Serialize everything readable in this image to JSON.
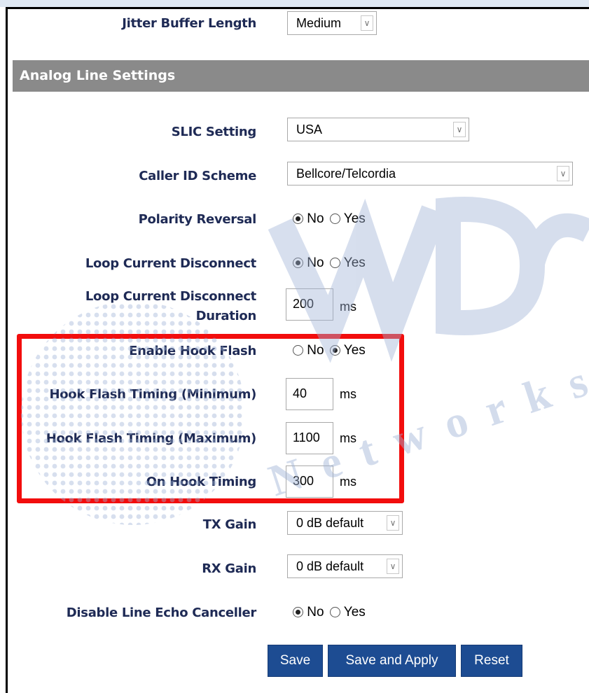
{
  "settings": {
    "jitter_buffer_label": "Jitter Buffer Length",
    "jitter_buffer_value": "Medium"
  },
  "section": {
    "title": "Analog Line Settings"
  },
  "fields": {
    "slic_label": "SLIC Setting",
    "slic_value": "USA",
    "caller_id_label": "Caller ID Scheme",
    "caller_id_value": "Bellcore/Telcordia",
    "polarity_label": "Polarity Reversal",
    "loop_disconnect_label": "Loop Current Disconnect",
    "loop_duration_label_1": "Loop Current Disconnect",
    "loop_duration_label_2": "Duration",
    "loop_duration_value": "200",
    "hook_flash_label": "Enable Hook Flash",
    "hook_min_label": "Hook Flash Timing (Minimum)",
    "hook_min_value": "40",
    "hook_max_label": "Hook Flash Timing (Maximum)",
    "hook_max_value": "1100",
    "on_hook_label": "On Hook Timing",
    "on_hook_value": "300",
    "tx_gain_label": "TX Gain",
    "tx_gain_value": "0 dB default",
    "rx_gain_label": "RX Gain",
    "rx_gain_value": "0 dB default",
    "echo_label": "Disable Line Echo Canceller"
  },
  "common": {
    "no": "No",
    "yes": "Yes",
    "ms": "ms"
  },
  "buttons": {
    "save": "Save",
    "save_apply": "Save and Apply",
    "reset": "Reset"
  },
  "watermark": {
    "brand": "WDC",
    "sub": "Networks",
    "color": "#9fb3d6"
  },
  "colors": {
    "section_bar": "#8a8a8a",
    "button": "#1d4c92",
    "label": "#1e2a55",
    "highlight": "#f20d0d"
  }
}
